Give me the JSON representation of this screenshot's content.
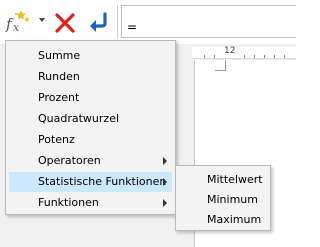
{
  "toolbar": {
    "formula_input_value": "=",
    "icons": {
      "function": "function-fx-icon",
      "dropdown": "chevron-down-icon",
      "cancel": "cancel-x-icon",
      "accept": "accept-return-icon"
    }
  },
  "ruler": {
    "label": "12"
  },
  "menu": {
    "items": [
      {
        "label": "Summe",
        "has_submenu": false
      },
      {
        "label": "Runden",
        "has_submenu": false
      },
      {
        "label": "Prozent",
        "has_submenu": false
      },
      {
        "label": "Quadratwurzel",
        "has_submenu": false
      },
      {
        "label": "Potenz",
        "has_submenu": false
      },
      {
        "label": "Operatoren",
        "has_submenu": true
      },
      {
        "label": "Statistische Funktionen",
        "has_submenu": true,
        "highlighted": true
      },
      {
        "label": "Funktionen",
        "has_submenu": true
      }
    ]
  },
  "submenu": {
    "items": [
      {
        "label": "Mittelwert"
      },
      {
        "label": "Minimum"
      },
      {
        "label": "Maximum"
      }
    ]
  },
  "colors": {
    "highlight": "#cce8ff",
    "menu_bg": "#f3f3f3",
    "cancel_red": "#e0201b",
    "accept_blue": "#1d63b8",
    "fx_gold": "#e6b800"
  }
}
